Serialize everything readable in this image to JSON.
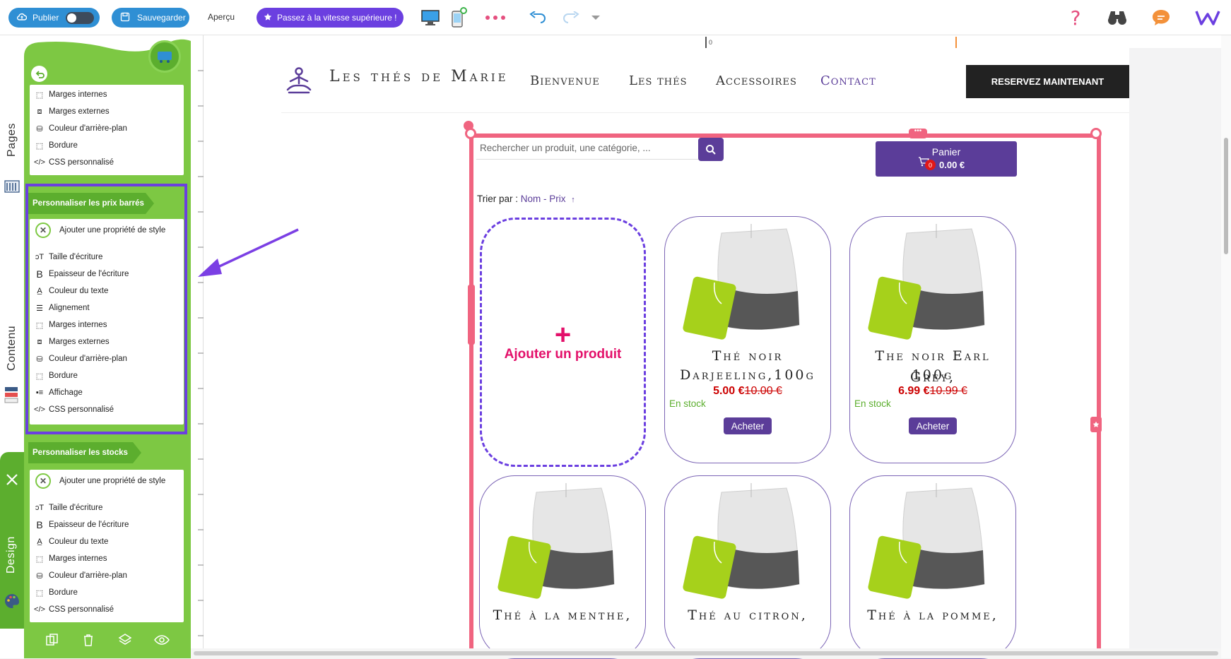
{
  "toolbar": {
    "publish_label": "Publier",
    "save_label": "Sauvegarder",
    "preview_label": "Aperçu",
    "upgrade_label": "Passez à la vitesse supérieure !",
    "icons": [
      "desktop-icon",
      "mobile-icon",
      "more-icon",
      "undo-icon",
      "redo-icon",
      "dropdown-icon",
      "help-icon",
      "binoculars-icon",
      "chat-icon",
      "logo-w-icon"
    ]
  },
  "side_tabs": {
    "pages": "Pages",
    "content": "Contenu",
    "design": "Design"
  },
  "panel": {
    "top_items": [
      "Marges internes",
      "Marges externes",
      "Couleur d'arrière-plan",
      "Bordure",
      "CSS personnalisé"
    ],
    "section1": {
      "title": "Personnaliser les prix barrés",
      "add_prop": "Ajouter une propriété de style",
      "items": [
        "Taille d'écriture",
        "Epaisseur de l'écriture",
        "Couleur du texte",
        "Alignement",
        "Marges internes",
        "Marges externes",
        "Couleur d'arrière-plan",
        "Bordure",
        "Affichage",
        "CSS personnalisé"
      ]
    },
    "section2": {
      "title": "Personnaliser les stocks",
      "add_prop": "Ajouter une propriété de style",
      "items": [
        "Taille d'écriture",
        "Epaisseur de l'écriture",
        "Couleur du texte",
        "Marges internes",
        "Couleur d'arrière-plan",
        "Bordure",
        "CSS personnalisé"
      ]
    }
  },
  "ruler": {
    "zero": "0"
  },
  "site": {
    "brand": "Les thés de Marie",
    "nav": [
      "Bienvenue",
      "Les thés",
      "Accessoires",
      "Contact"
    ],
    "cta": "RESERVEZ MAINTENANT"
  },
  "shop": {
    "search_placeholder": "Rechercher un produit, une catégorie, ...",
    "cart_label": "Panier",
    "cart_total": "0.00 €",
    "cart_count": "0",
    "sort_label": "Trier par : ",
    "sort_name": "Nom",
    "sort_sep": " - ",
    "sort_price": "Prix",
    "sort_arrow": "↑",
    "add_product": "Ajouter un produit",
    "add_plus": "+",
    "products": [
      {
        "title": "Thé noir Darjeeling,100g",
        "line1": "Thé noir",
        "line2": "Darjeeling,100g",
        "price": "5.00 €",
        "old_price": "10.00 €",
        "stock": "En stock",
        "buy": "Acheter"
      },
      {
        "title": "The noir Earl Grey, 100g",
        "line1": "The noir Earl Grey,",
        "line2": "100g",
        "price": "6.99 €",
        "old_price": "10.99 €",
        "stock": "En stock",
        "buy": "Acheter"
      },
      {
        "title": "Thé à la menthe,",
        "line1": "Thé à la menthe,",
        "line2": ""
      },
      {
        "title": "Thé au citron,",
        "line1": "Thé au citron,",
        "line2": ""
      },
      {
        "title": "Thé à la pomme,",
        "line1": "Thé à la pomme,",
        "line2": ""
      }
    ]
  },
  "colors": {
    "accent": "#6b3fe0",
    "panel_green": "#7dc843",
    "selection_pink": "#f06480",
    "shop_purple": "#5b3d99",
    "price_red": "#cc0000"
  }
}
